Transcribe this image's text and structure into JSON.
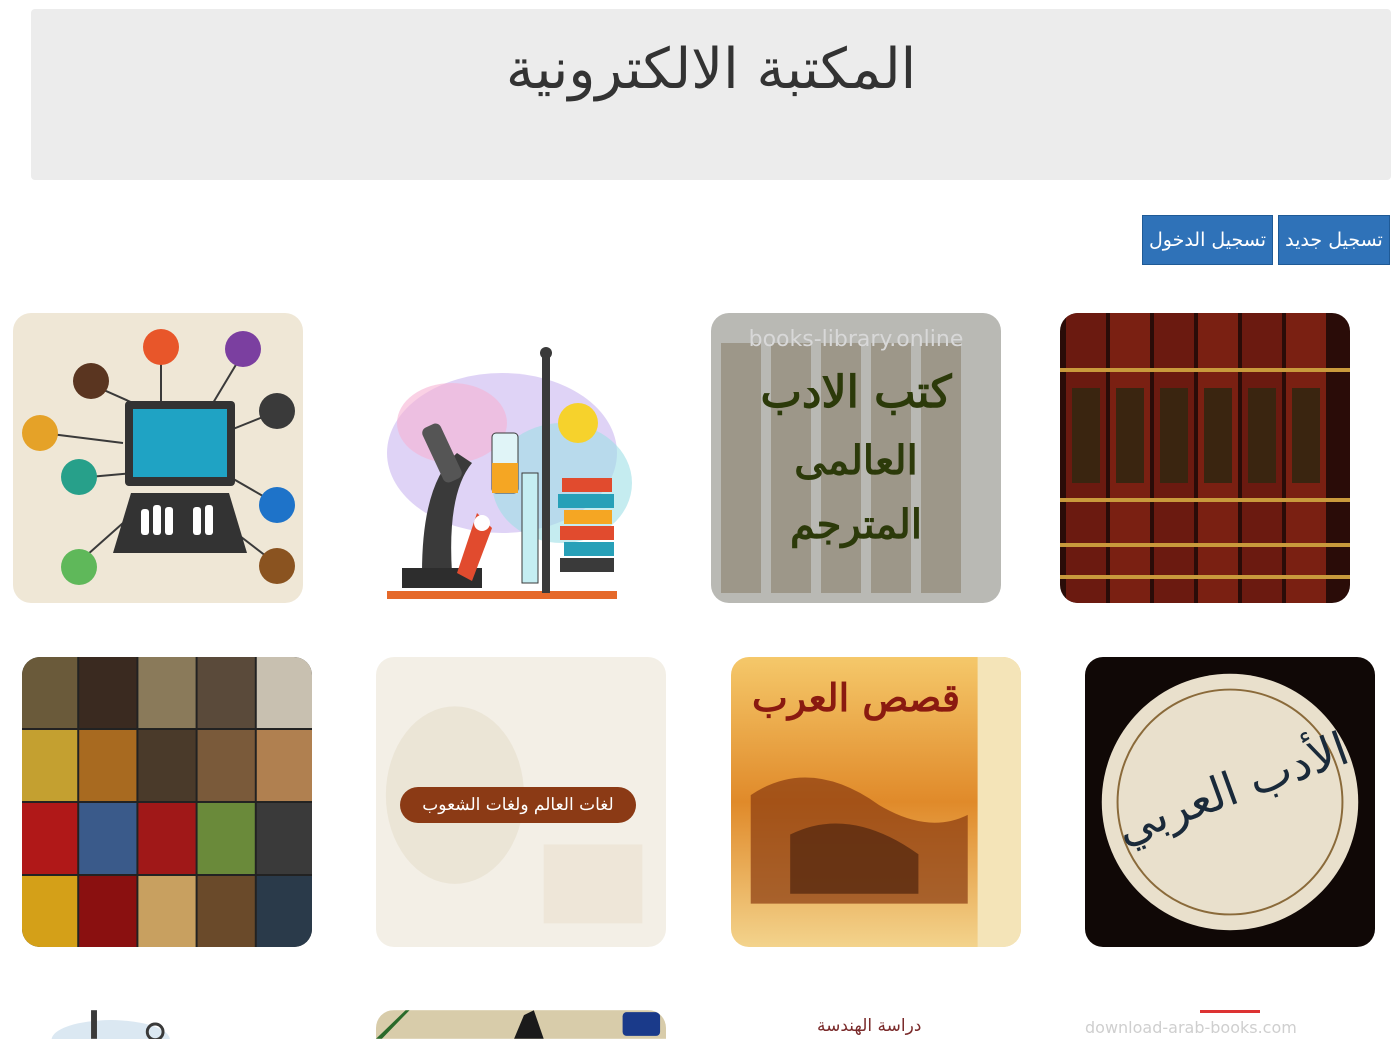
{
  "header": {
    "title": "المكتبة الالكترونية"
  },
  "auth": {
    "register_label": "تسجيل جديد",
    "login_label": "تسجيل الدخول"
  },
  "categories": {
    "translated_lit": {
      "line1": "كتب الادب",
      "line2": "العالمى",
      "line3": "المترجم",
      "watermark": "books-library.online"
    },
    "languages": {
      "caption": "لغات العالم ولغات الشعوب"
    },
    "arab_stories": {
      "title": "قصص العرب"
    },
    "arabic_lit": {
      "title": "الأدب العربي"
    },
    "engineering": {
      "label": "دراسة الهندسة"
    },
    "downloads": {
      "label": "download-arab-books.com"
    }
  }
}
